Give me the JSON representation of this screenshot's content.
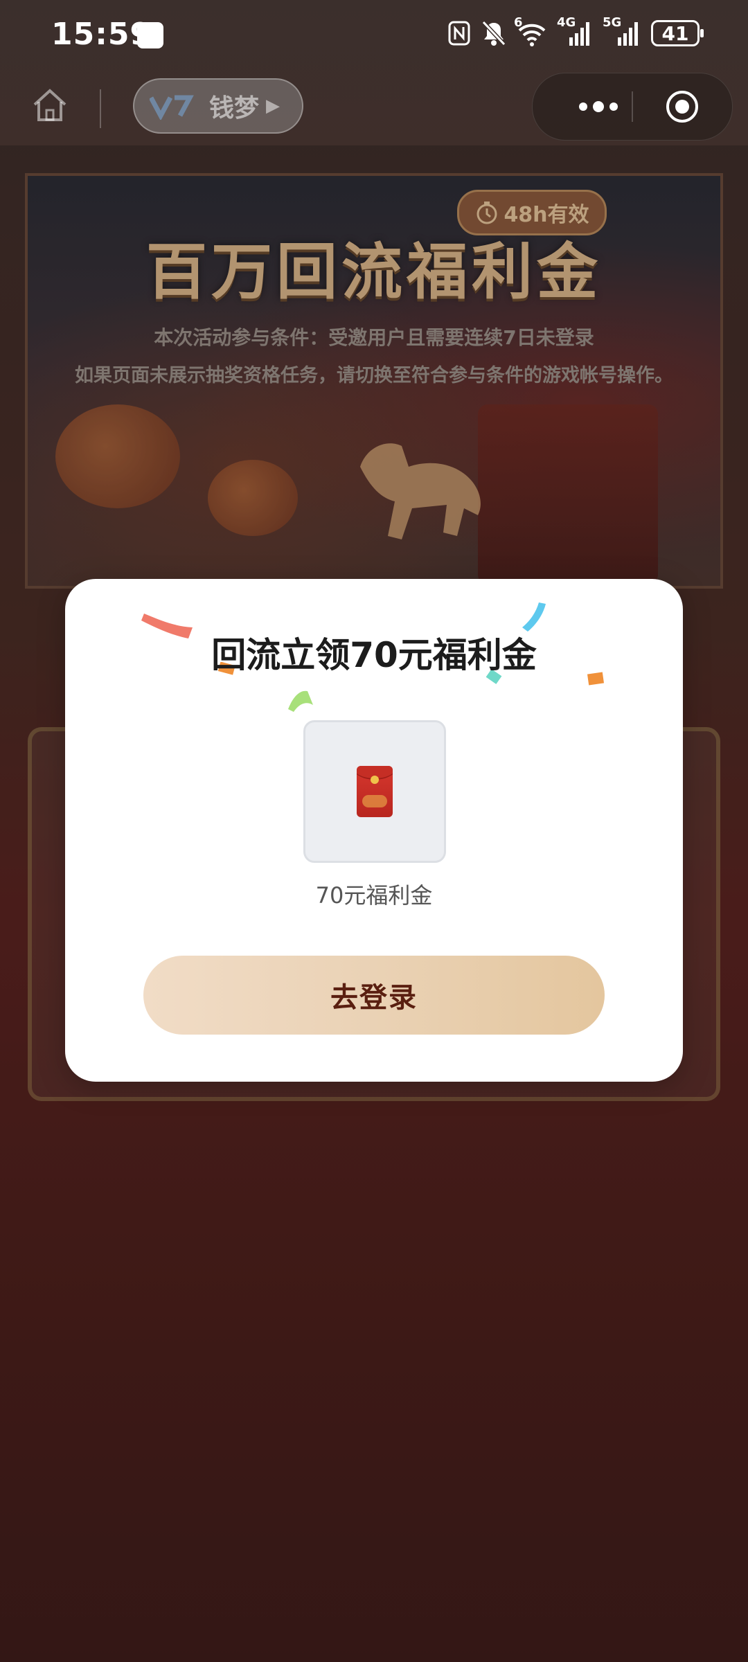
{
  "status_bar": {
    "time": "15:59",
    "signal_1": "4G",
    "signal_2": "5G",
    "wifi_tag": "6",
    "battery": "41"
  },
  "topbar": {
    "game_name": "钱梦"
  },
  "banner": {
    "valid_badge": "48h有效",
    "title": "百万回流福利金",
    "condition": "本次活动参与条件：受邀用户且需要连续7日未登录",
    "note": "如果页面未展示抽奖资格任务，请切换至符合参与条件的游戏帐号操作。"
  },
  "modal": {
    "title": "回流立领70元福利金",
    "reward_label": "70元福利金",
    "login_button": "去登录"
  },
  "colors": {
    "accent_gold": "#e4c69e",
    "button_text": "#5a1f10",
    "envelope_red": "#d6372e"
  }
}
